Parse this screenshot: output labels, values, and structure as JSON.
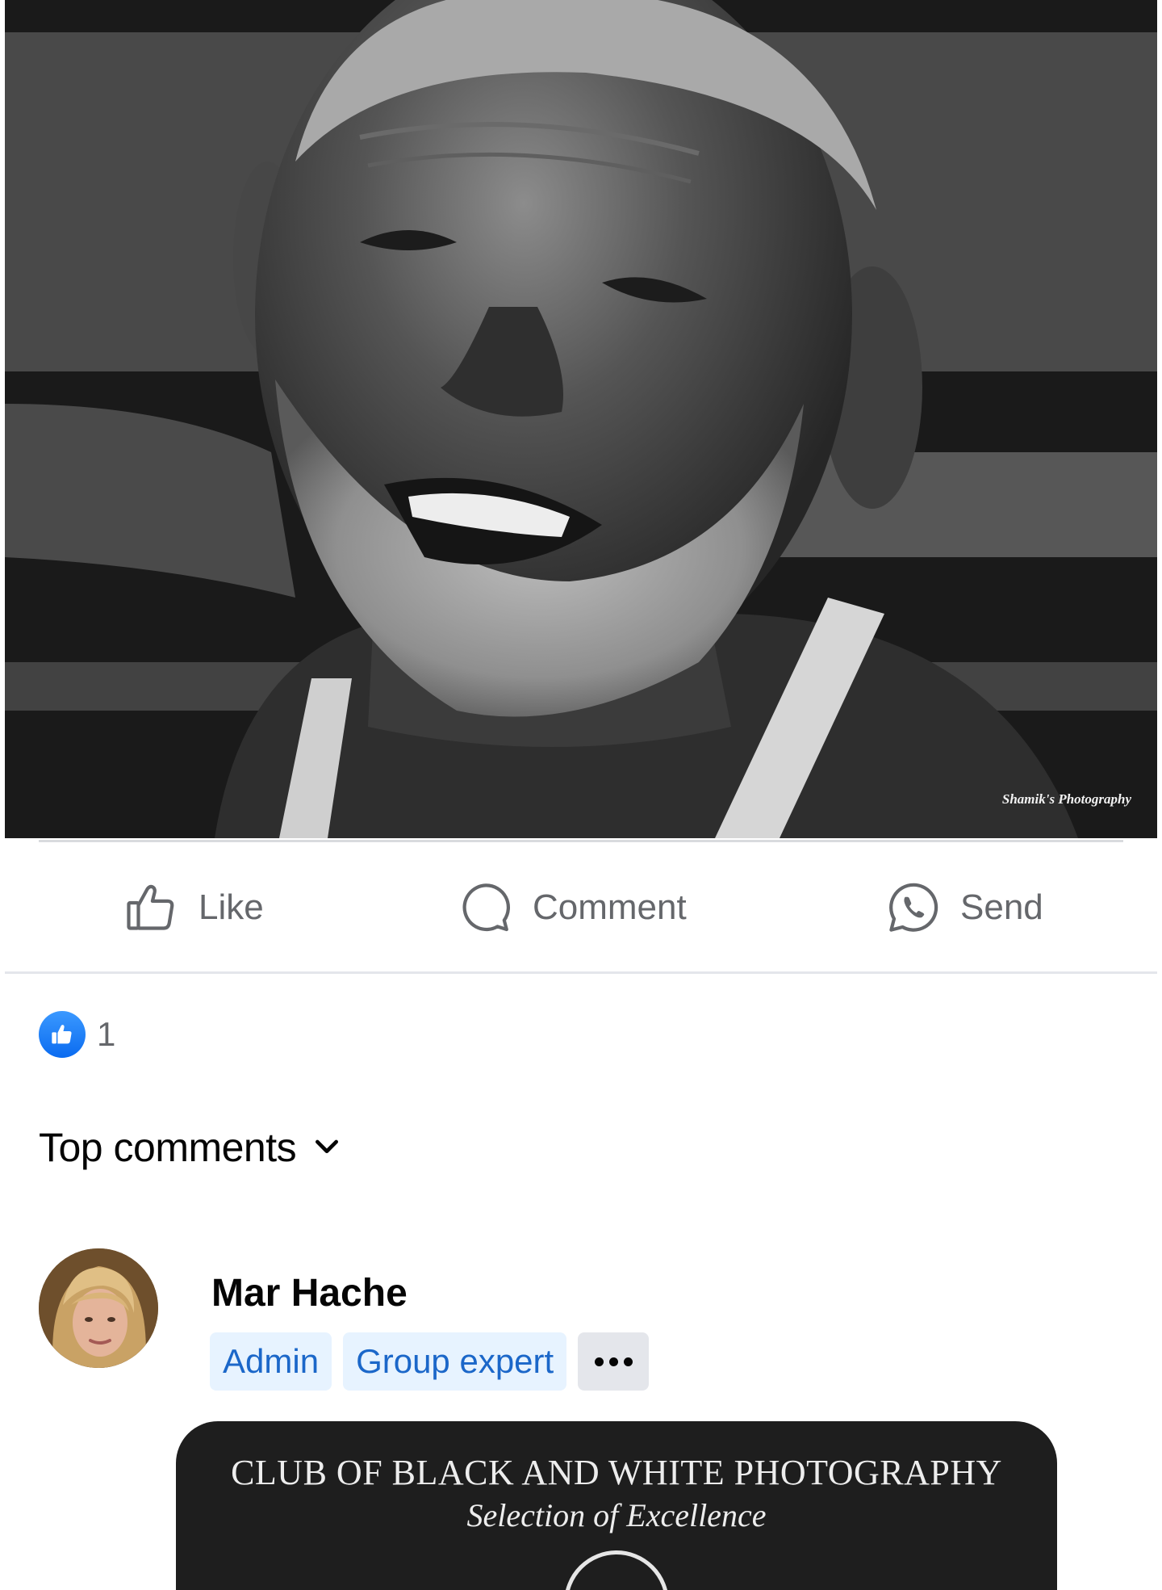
{
  "post": {
    "photo_watermark": "Shamik's Photography"
  },
  "actions": {
    "like_label": "Like",
    "comment_label": "Comment",
    "send_label": "Send"
  },
  "reactions": {
    "count": "1",
    "type_icon": "thumbs-up-icon"
  },
  "comments_section": {
    "sort_label": "Top comments",
    "sort_icon": "chevron-down-icon"
  },
  "comment": {
    "author": "Mar Hache",
    "badges": [
      "Admin",
      "Group expert"
    ],
    "more_icon": "more-dots-icon",
    "attachment": {
      "title": "CLUB OF BLACK AND WHITE PHOTOGRAPHY",
      "subtitle": "Selection of Excellence"
    }
  },
  "colors": {
    "action_text": "#65676b",
    "like_blue": "#0a6bf0",
    "badge_bg": "#e7f3ff",
    "badge_text": "#1b67c9"
  }
}
